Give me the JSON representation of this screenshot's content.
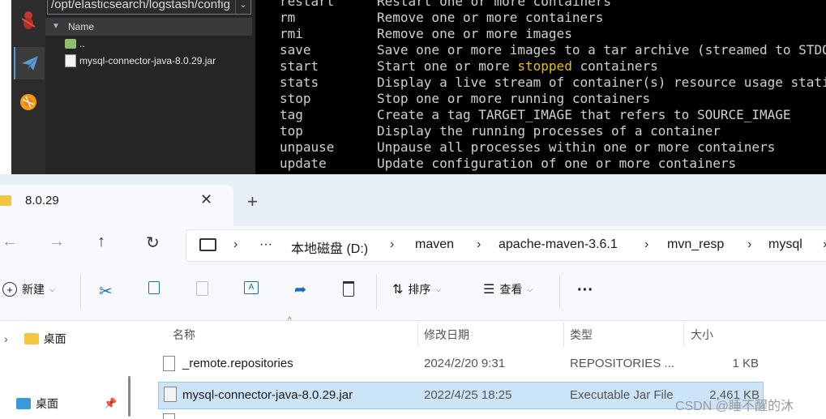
{
  "sftp": {
    "path": "/opt/elasticsearch/logstash/config",
    "header": "Name",
    "items": [
      {
        "name": ".."
      },
      {
        "name": "mysql-connector-java-8.0.29.jar"
      }
    ]
  },
  "terminal": {
    "lines": [
      {
        "cmd": "restart",
        "desc": "Restart one or more containers"
      },
      {
        "cmd": "rm",
        "desc": "Remove one or more containers"
      },
      {
        "cmd": "rmi",
        "desc": "Remove one or more images"
      },
      {
        "cmd": "save",
        "desc": "Save one or more images to a tar archive (streamed to STDOUT by default)"
      },
      {
        "cmd": "start",
        "desc_a": "Start one or more ",
        "desc_hl": "stopped",
        "desc_b": " containers"
      },
      {
        "cmd": "stats",
        "desc": "Display a live stream of container(s) resource usage statistics"
      },
      {
        "cmd": "stop",
        "desc": "Stop one or more running containers"
      },
      {
        "cmd": "tag",
        "desc": "Create a tag TARGET_IMAGE that refers to SOURCE_IMAGE"
      },
      {
        "cmd": "top",
        "desc": "Display the running processes of a container"
      },
      {
        "cmd": "unpause",
        "desc": "Unpause all processes within one or more containers"
      },
      {
        "cmd": "update",
        "desc": "Update configuration of one or more containers"
      }
    ],
    "highlight_color": "#e6c000"
  },
  "explorer": {
    "tab_title": "8.0.29",
    "breadcrumb": [
      "本地磁盘 (D:)",
      "maven",
      "apache-maven-3.6.1",
      "mvn_resp",
      "mysql"
    ],
    "toolbar": {
      "new_label": "新建",
      "sort_label": "排序",
      "view_label": "查看",
      "more": "···"
    },
    "nav": [
      {
        "label": "桌面"
      },
      {
        "label": "桌面"
      }
    ],
    "columns": {
      "name": "名称",
      "date": "修改日期",
      "type": "类型",
      "size": "大小"
    },
    "files": [
      {
        "name": "_remote.repositories",
        "date": "2024/2/20 9:31",
        "type": "REPOSITORIES ...",
        "size": "1 KB"
      },
      {
        "name": "mysql-connector-java-8.0.29.jar",
        "date": "2022/4/25 18:25",
        "type": "Executable Jar File",
        "size": "2,461 KB"
      }
    ],
    "selection_color": "#cce4f7"
  },
  "watermark": "CSDN @睡不醒的沐"
}
